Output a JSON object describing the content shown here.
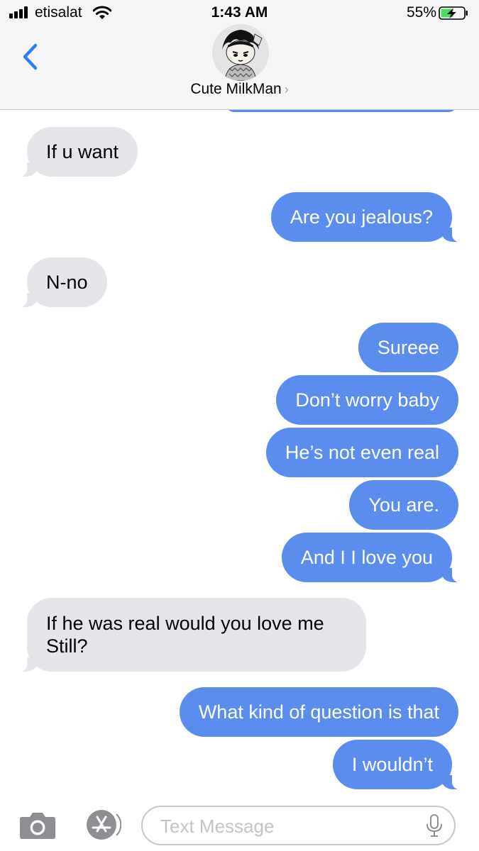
{
  "status_bar": {
    "carrier": "etisalat",
    "time": "1:43 AM",
    "battery_percent": "55%",
    "signal_bars": 4,
    "battery_level": 0.55,
    "charging": true
  },
  "header": {
    "contact_name": "Cute MilkMan",
    "chevron": "›",
    "back_icon": "chevron-left-icon"
  },
  "messages": [
    {
      "side": "in",
      "text": "If u want"
    },
    {
      "side": "out",
      "text": "Are you jealous?"
    },
    {
      "side": "in",
      "text": "N-no"
    },
    {
      "side": "out",
      "text": "Sureee"
    },
    {
      "side": "out",
      "text": "Don’t worry baby"
    },
    {
      "side": "out",
      "text": "He’s not even real"
    },
    {
      "side": "out",
      "text": "You are."
    },
    {
      "side": "out",
      "text": "And I I love you"
    },
    {
      "side": "in",
      "text": "If he was real would you love me Still?"
    },
    {
      "side": "out",
      "text": "What kind of question is that"
    },
    {
      "side": "out",
      "text": "I wouldn’t"
    }
  ],
  "input_bar": {
    "placeholder": "Text Message",
    "camera_icon": "camera-icon",
    "apps_icon": "app-store-icon",
    "mic_icon": "microphone-icon"
  },
  "colors": {
    "outgoing_bubble": "#5b8def",
    "incoming_bubble": "#e5e5ea",
    "accent": "#2f7cf6"
  }
}
